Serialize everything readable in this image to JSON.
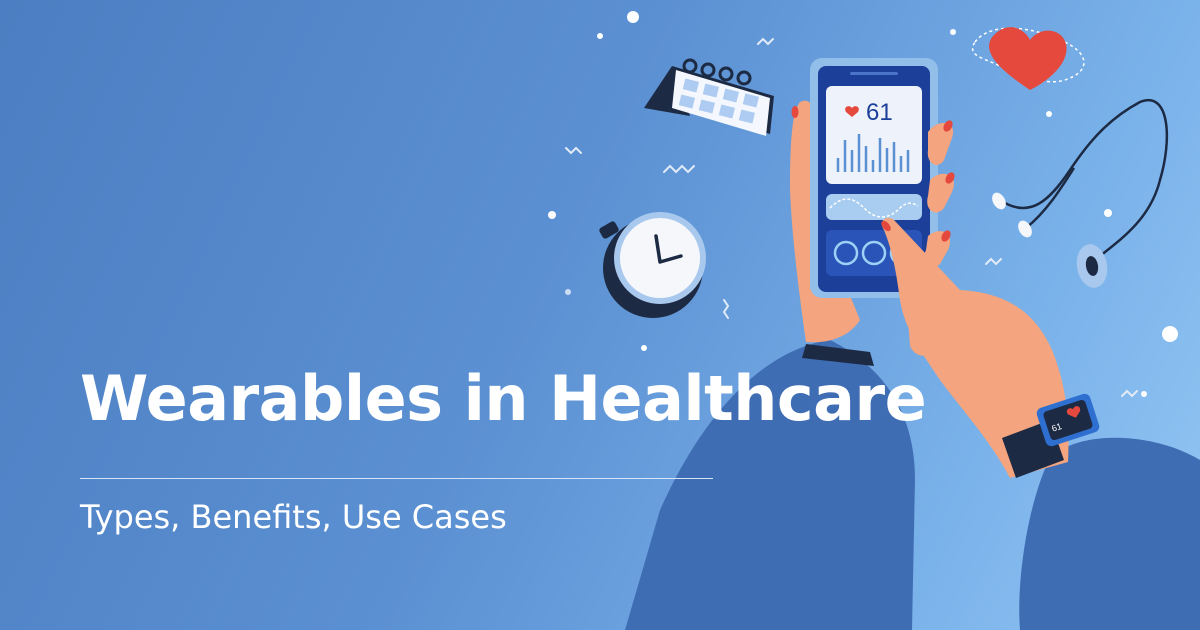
{
  "hero": {
    "title": "Wearables in Healthcare",
    "subtitle": "Types, Benefits, Use Cases"
  },
  "phone": {
    "heart_rate": "61"
  },
  "smartwatch": {
    "heart_rate": "61"
  },
  "icons": [
    "calendar-icon",
    "stopwatch-icon",
    "heart-icon",
    "stethoscope-icon",
    "smartphone-illustration",
    "smartwatch-illustration"
  ],
  "colors": {
    "background_start": "#4b7ec2",
    "background_end": "#93c6f3",
    "sleeve": "#3f6db4",
    "skin": "#f4a47e",
    "accent_red": "#e5483c",
    "phone_screen": "#1c3f9a"
  }
}
